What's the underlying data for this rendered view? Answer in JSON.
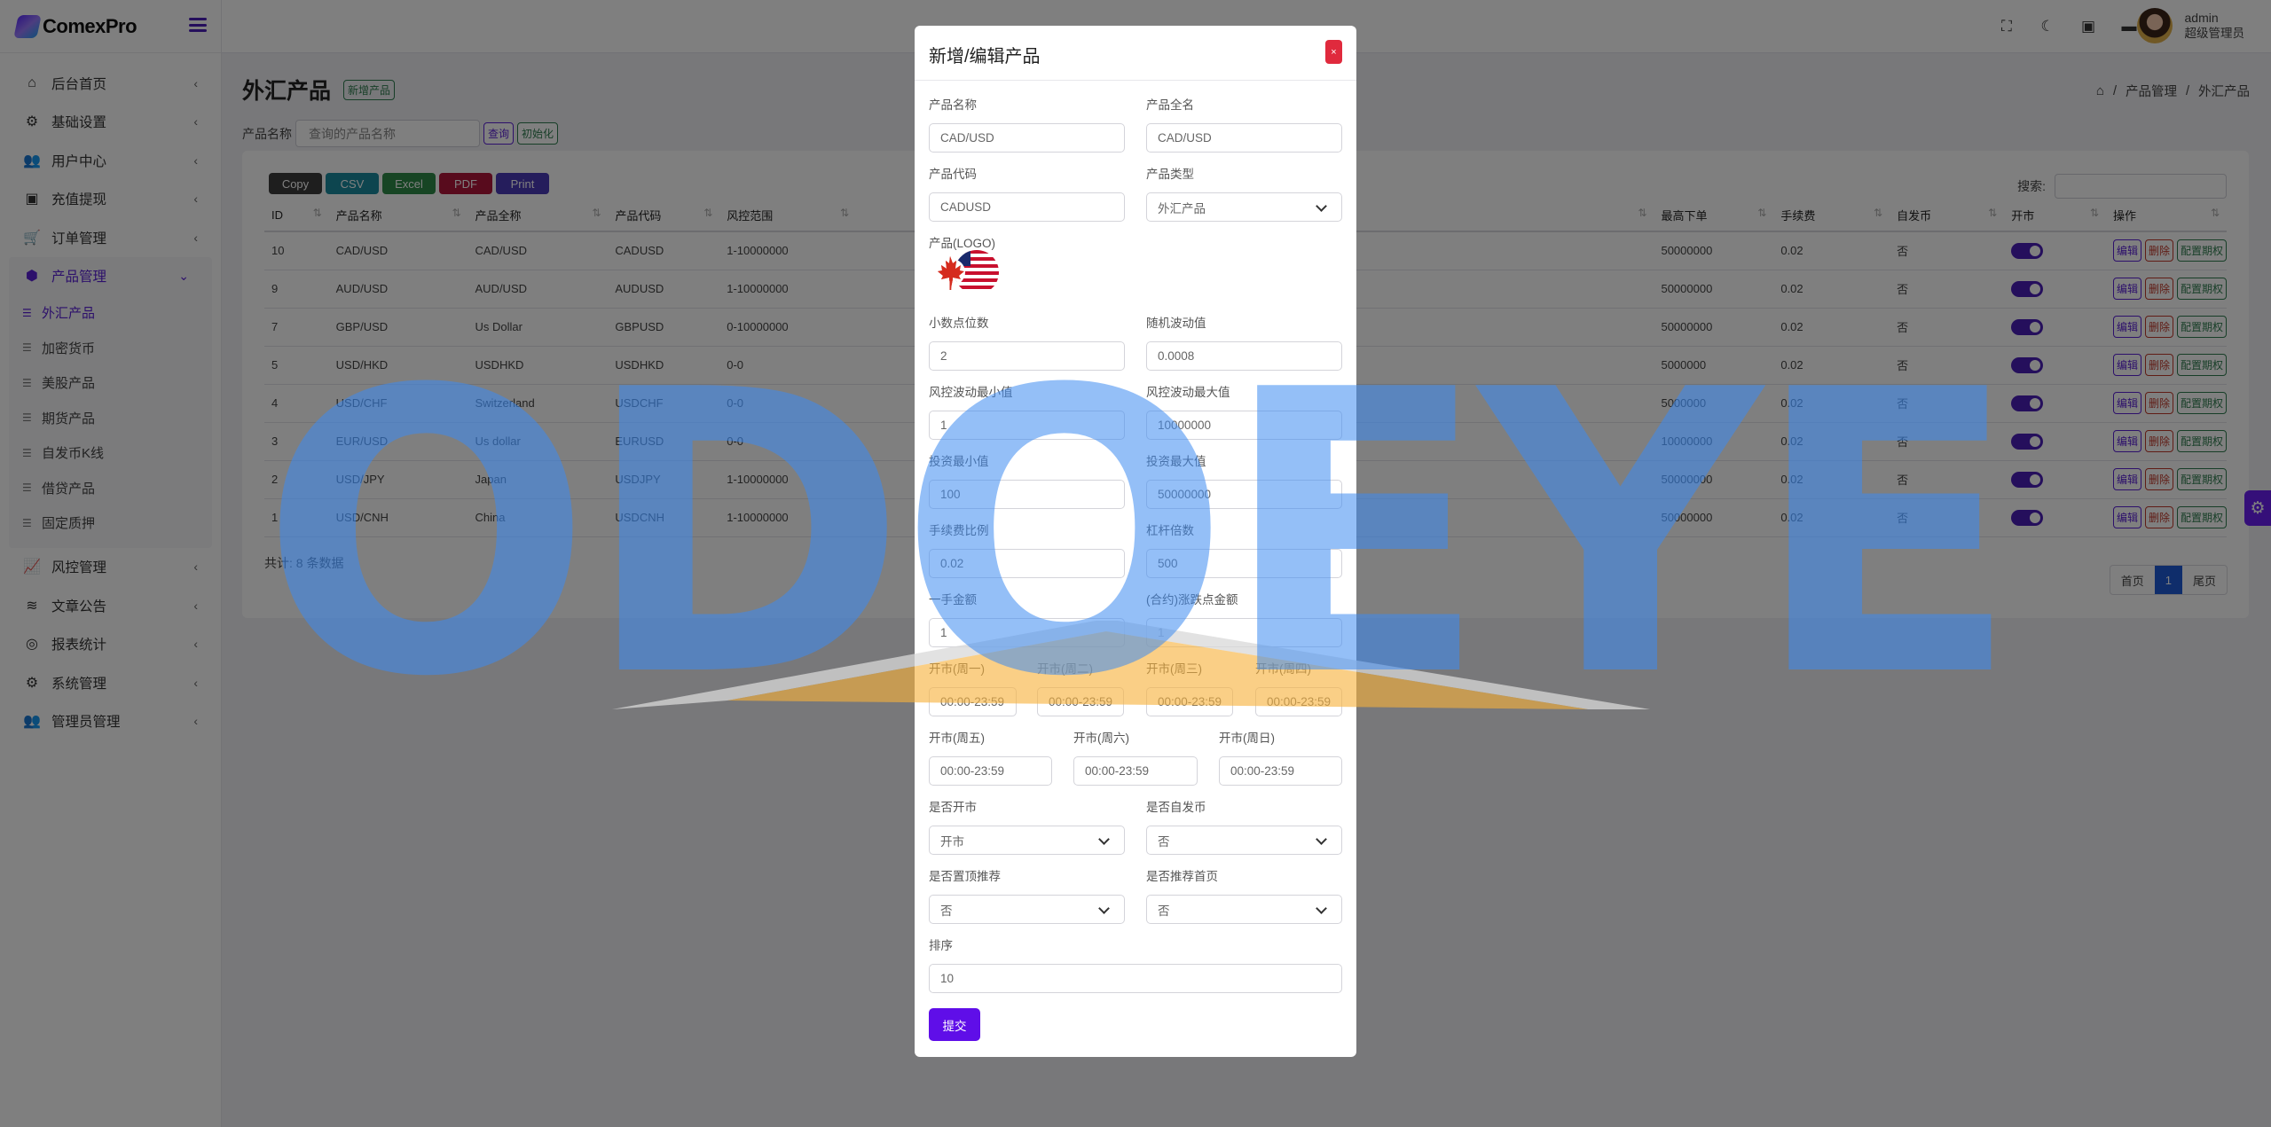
{
  "brand": {
    "name": "ComexPro"
  },
  "sidebar": {
    "items": [
      {
        "label": "后台首页",
        "icon": "home-icon",
        "glyph": "⌂"
      },
      {
        "label": "基础设置",
        "icon": "gears-icon",
        "glyph": "⚙"
      },
      {
        "label": "用户中心",
        "icon": "users-icon",
        "glyph": "👥"
      },
      {
        "label": "充值提现",
        "icon": "money-icon",
        "glyph": "▣"
      },
      {
        "label": "订单管理",
        "icon": "cart-icon",
        "glyph": "🛒"
      }
    ],
    "active_group": {
      "label": "产品管理",
      "icon": "cubes-icon",
      "children": [
        {
          "label": "外汇产品",
          "active": true
        },
        {
          "label": "加密货币"
        },
        {
          "label": "美股产品"
        },
        {
          "label": "期货产品"
        },
        {
          "label": "自发币K线"
        },
        {
          "label": "借贷产品"
        },
        {
          "label": "固定质押"
        }
      ]
    },
    "items_after": [
      {
        "label": "风控管理",
        "icon": "chart-line-icon",
        "glyph": "📈"
      },
      {
        "label": "文章公告",
        "icon": "layers-icon",
        "glyph": "≋"
      },
      {
        "label": "报表统计",
        "icon": "database-icon",
        "glyph": "◎"
      },
      {
        "label": "系统管理",
        "icon": "gear-icon",
        "glyph": "⚙"
      },
      {
        "label": "管理员管理",
        "icon": "user-group-icon",
        "glyph": "👥"
      }
    ]
  },
  "topbar": {
    "icons": [
      "fullscreen-icon",
      "moon-icon",
      "money-icon",
      "message-icon"
    ],
    "user": {
      "name": "admin",
      "role": "超级管理员"
    }
  },
  "page": {
    "title": "外汇产品",
    "add_button": "新增产品",
    "breadcrumb": [
      "产品管理",
      "外汇产品"
    ],
    "filter": {
      "label": "产品名称",
      "placeholder": "查询的产品名称",
      "query_button": "查询",
      "reset_button": "初始化"
    }
  },
  "table": {
    "export_buttons": [
      {
        "label": "Copy",
        "color": "#3c3c3c"
      },
      {
        "label": "CSV",
        "color": "#1a8a9e"
      },
      {
        "label": "Excel",
        "color": "#2e8a48"
      },
      {
        "label": "PDF",
        "color": "#b0173a"
      },
      {
        "label": "Print",
        "color": "#4b3ab8"
      }
    ],
    "search_label": "搜索:",
    "columns": [
      "ID",
      "产品名称",
      "产品全称",
      "产品代码",
      "风控范围",
      "最高下单",
      "手续费",
      "自发币",
      "开市",
      "操作"
    ],
    "rows": [
      {
        "id": "10",
        "name": "CAD/USD",
        "full": "CAD/USD",
        "code": "CADUSD",
        "range": "1-10000000",
        "max": "50000000",
        "fee": "0.02",
        "self": "否",
        "open": true
      },
      {
        "id": "9",
        "name": "AUD/USD",
        "full": "AUD/USD",
        "code": "AUDUSD",
        "range": "1-10000000",
        "max": "50000000",
        "fee": "0.02",
        "self": "否",
        "open": true
      },
      {
        "id": "7",
        "name": "GBP/USD",
        "full": "Us Dollar",
        "code": "GBPUSD",
        "range": "0-10000000",
        "max": "50000000",
        "fee": "0.02",
        "self": "否",
        "open": true
      },
      {
        "id": "5",
        "name": "USD/HKD",
        "full": "USDHKD",
        "code": "USDHKD",
        "range": "0-0",
        "max": "5000000",
        "fee": "0.02",
        "self": "否",
        "open": true
      },
      {
        "id": "4",
        "name": "USD/CHF",
        "full": "Switzerland",
        "code": "USDCHF",
        "range": "0-0",
        "max": "5000000",
        "fee": "0.02",
        "self": "否",
        "open": true
      },
      {
        "id": "3",
        "name": "EUR/USD",
        "full": "Us dollar",
        "code": "EURUSD",
        "range": "0-0",
        "max": "10000000",
        "fee": "0.02",
        "self": "否",
        "open": true
      },
      {
        "id": "2",
        "name": "USD/JPY",
        "full": "Japan",
        "code": "USDJPY",
        "range": "1-10000000",
        "max": "50000000",
        "fee": "0.02",
        "self": "否",
        "open": true
      },
      {
        "id": "1",
        "name": "USD/CNH",
        "full": "China",
        "code": "USDCNH",
        "range": "1-10000000",
        "max": "50000000",
        "fee": "0.02",
        "self": "否",
        "open": true
      }
    ],
    "actions": {
      "edit": "编辑",
      "delete": "删除",
      "config": "配置期权"
    },
    "total_text": "共计: 8 条数据",
    "pager": {
      "first": "首页",
      "current": "1",
      "last": "尾页"
    }
  },
  "modal": {
    "title": "新增/编辑产品",
    "close": "×",
    "fields": {
      "name": {
        "label": "产品名称",
        "value": "CAD/USD"
      },
      "full_name": {
        "label": "产品全名",
        "value": "CAD/USD"
      },
      "code": {
        "label": "产品代码",
        "value": "CADUSD"
      },
      "type": {
        "label": "产品类型",
        "value": "外汇产品"
      },
      "logo": {
        "label": "产品(LOGO)"
      },
      "decimals": {
        "label": "小数点位数",
        "value": "2"
      },
      "random_fluct": {
        "label": "随机波动值",
        "value": "0.0008"
      },
      "risk_min": {
        "label": "风控波动最小值",
        "value": "1"
      },
      "risk_max": {
        "label": "风控波动最大值",
        "value": "10000000"
      },
      "invest_min": {
        "label": "投资最小值",
        "value": "100"
      },
      "invest_max": {
        "label": "投资最大值",
        "value": "50000000"
      },
      "fee_ratio": {
        "label": "手续费比例",
        "value": "0.02"
      },
      "leverage": {
        "label": "杠杆倍数",
        "value": "500"
      },
      "lot_amount": {
        "label": "一手金额",
        "value": "1"
      },
      "point_amount": {
        "label": "(合约)涨跌点金额",
        "value": "1"
      },
      "mon": {
        "label": "开市(周一)",
        "value": "00:00-23:59"
      },
      "tue": {
        "label": "开市(周二)",
        "value": "00:00-23:59"
      },
      "wed": {
        "label": "开市(周三)",
        "value": "00:00-23:59"
      },
      "thu": {
        "label": "开市(周四)",
        "value": "00:00-23:59"
      },
      "fri": {
        "label": "开市(周五)",
        "value": "00:00-23:59"
      },
      "sat": {
        "label": "开市(周六)",
        "value": "00:00-23:59"
      },
      "sun": {
        "label": "开市(周日)",
        "value": "00:00-23:59"
      },
      "is_open": {
        "label": "是否开市",
        "value": "开市"
      },
      "is_self": {
        "label": "是否自发币",
        "value": "否"
      },
      "is_top": {
        "label": "是否置顶推荐",
        "value": "否"
      },
      "is_home": {
        "label": "是否推荐首页",
        "value": "否"
      },
      "sort": {
        "label": "排序",
        "value": "10"
      }
    },
    "submit": "提交"
  },
  "watermark": {
    "text": "ODOEYE"
  }
}
